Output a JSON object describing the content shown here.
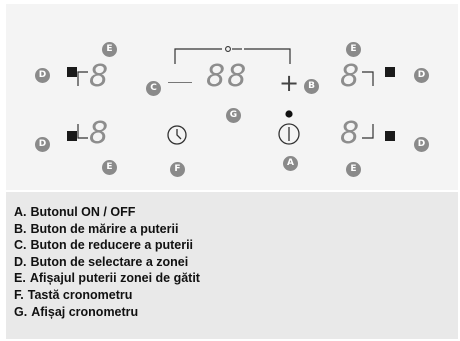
{
  "panel": {
    "zone_digit": "8",
    "timer_digits": "88",
    "minus_symbol": "—",
    "plus_symbol": "+"
  },
  "badges": {
    "A": "A",
    "B": "B",
    "C": "C",
    "D": "D",
    "E": "E",
    "F": "F",
    "G": "G"
  },
  "legend": [
    {
      "key": "A.",
      "text": "Butonul ON / OFF"
    },
    {
      "key": "B.",
      "text": "Buton de mărire a puterii"
    },
    {
      "key": "C.",
      "text": "Buton de reducere a puterii"
    },
    {
      "key": "D.",
      "text": "Buton de selectare a zonei"
    },
    {
      "key": "E.",
      "text": "Afișajul puterii zonei de gătit"
    },
    {
      "key": "F.",
      "text": "Tastă cronometru"
    },
    {
      "key": "G.",
      "text": "Afișaj cronometru"
    }
  ],
  "colors": {
    "badge": "#8a8a8a",
    "segment": "#8d8d8d",
    "panel": "#f4f4f4",
    "legend_bg": "#e9e9e9"
  }
}
